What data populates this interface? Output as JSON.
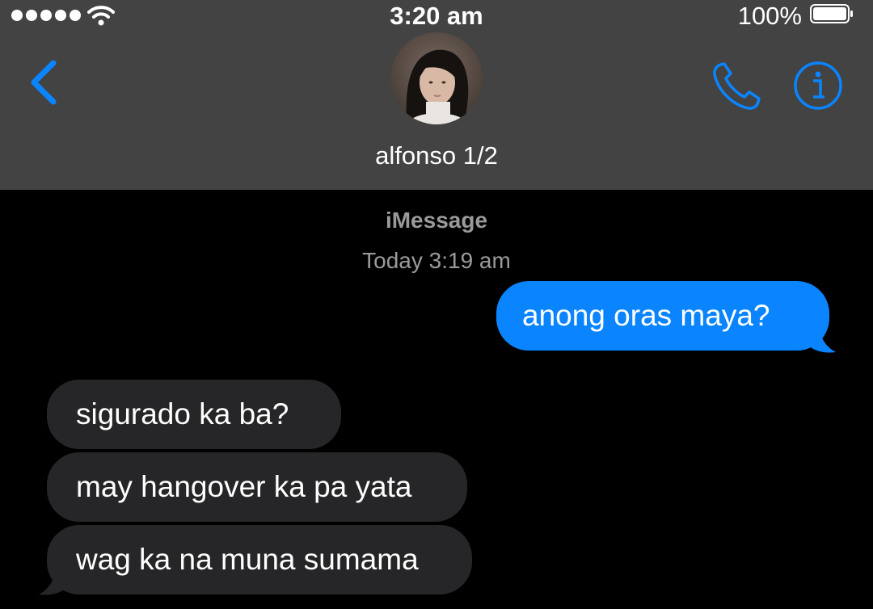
{
  "status_bar": {
    "time": "3:20 am",
    "battery_percent": "100%",
    "signal_bars": 5,
    "wifi": true
  },
  "header": {
    "contact_name": "alfonso 1/2",
    "back_icon": "chevron-left-icon",
    "call_icon": "phone-icon",
    "info_icon": "info-icon"
  },
  "conversation": {
    "service": "iMessage",
    "timestamp": "Today 3:19 am",
    "messages": [
      {
        "from": "me",
        "text": "anong oras maya?"
      },
      {
        "from": "contact",
        "text": "sigurado ka ba?"
      },
      {
        "from": "contact",
        "text": "may hangover ka pa yata"
      },
      {
        "from": "contact",
        "text": "wag ka na muna sumama"
      }
    ]
  },
  "colors": {
    "header_bg": "#434343",
    "background": "#000000",
    "accent": "#0a84ff",
    "sent_bubble": "#0a84ff",
    "received_bubble": "#262628",
    "meta_text": "#9a9a9a"
  }
}
